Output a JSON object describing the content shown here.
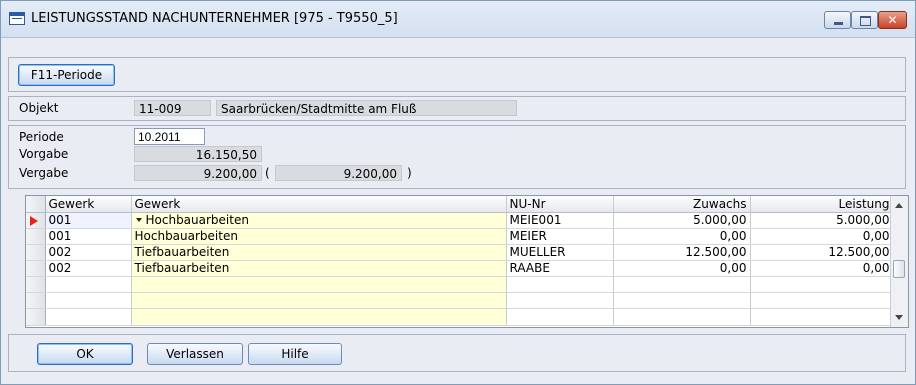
{
  "window": {
    "title": "LEISTUNGSSTAND NACHUNTERNEHMER  [975 - T9550_5]",
    "minimize": "minimize",
    "maximize": "maximize",
    "close": "✕"
  },
  "toolbar": {
    "period_button": "F11-Periode"
  },
  "objekt": {
    "label": "Objekt",
    "number": "11-009",
    "name": "Saarbrücken/Stadtmitte am Fluß"
  },
  "summary": {
    "periode_label": "Periode",
    "periode_value": "10.2011",
    "vorgabe_label": "Vorgabe",
    "vorgabe_value": "16.150,50",
    "vergabe_label": "Vergabe",
    "vergabe_value": "9.200,00",
    "paren_open": "(",
    "vergabe_value2": "9.200,00",
    "paren_close": ")"
  },
  "grid": {
    "columns": [
      "Gewerk",
      "Gewerk",
      "NU-Nr",
      "Zuwachs",
      "Leistung"
    ],
    "rows": [
      {
        "code": "001",
        "name": "Hochbauarbeiten",
        "nu": "MEIE001",
        "zuwachs": "5.000,00",
        "leistung": "5.000,00"
      },
      {
        "code": "001",
        "name": "Hochbauarbeiten",
        "nu": "MEIER",
        "zuwachs": "0,00",
        "leistung": "0,00"
      },
      {
        "code": "002",
        "name": "Tiefbauarbeiten",
        "nu": "MUELLER",
        "zuwachs": "12.500,00",
        "leistung": "12.500,00"
      },
      {
        "code": "002",
        "name": "Tiefbauarbeiten",
        "nu": "RAABE",
        "zuwachs": "0,00",
        "leistung": "0,00"
      }
    ]
  },
  "buttons": {
    "ok": "OK",
    "verlassen": "Verlassen",
    "hilfe": "Hilfe"
  },
  "colors": {
    "accent": "#2f6dbd",
    "editable_cell": "#ffffd8",
    "row_marker": "#e0261b"
  },
  "icons": [
    "table-icon",
    "minimize-icon",
    "maximize-icon",
    "close-icon",
    "row-pointer-icon",
    "dropdown-icon",
    "scroll-up-icon",
    "scroll-down-icon"
  ]
}
